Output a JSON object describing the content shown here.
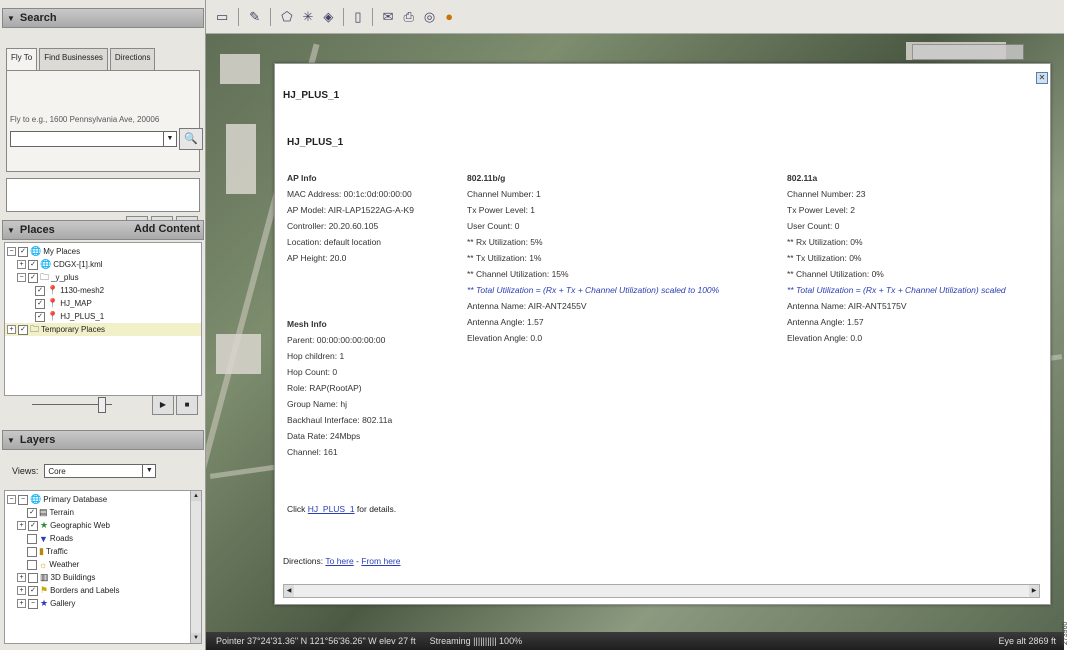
{
  "search": {
    "title": "Search",
    "tabs": [
      "Fly To",
      "Find Businesses",
      "Directions"
    ],
    "hint": "Fly to e.g., 1600 Pennsylvania Ave, 20006",
    "input_value": "",
    "buttons": {
      "play": "▶",
      "stop": "■",
      "close": "✕"
    }
  },
  "places": {
    "title": "Places",
    "add_content": "Add Content",
    "items": [
      {
        "label": "My Places"
      },
      {
        "label": "CDGX-[1].kml"
      },
      {
        "label": "_y_plus"
      },
      {
        "label": "1130-mesh2"
      },
      {
        "label": "HJ_MAP"
      },
      {
        "label": "HJ_PLUS_1"
      },
      {
        "label": "Temporary Places"
      }
    ]
  },
  "layers": {
    "title": "Layers",
    "views_label": "Views:",
    "views_value": "Core",
    "items": [
      {
        "label": "Primary Database"
      },
      {
        "label": "Terrain"
      },
      {
        "label": "Geographic Web"
      },
      {
        "label": "Roads"
      },
      {
        "label": "Traffic"
      },
      {
        "label": "Weather"
      },
      {
        "label": "3D Buildings"
      },
      {
        "label": "Borders and Labels"
      },
      {
        "label": "Gallery"
      }
    ]
  },
  "balloon": {
    "title": "HJ_PLUS_1",
    "subtitle": "HJ_PLUS_1",
    "ap_info": {
      "heading": "AP Info",
      "lines": [
        "MAC Address: 00:1c:0d:00:00:00",
        "AP Model: AIR-LAP1522AG-A-K9",
        "Controller: 20.20.60.105",
        "Location: default location",
        "AP Height: 20.0"
      ]
    },
    "mesh_info": {
      "heading": "Mesh Info",
      "lines": [
        "Parent: 00:00:00:00:00:00",
        "Hop children: 1",
        "Hop Count: 0",
        "Role: RAP(RootAP)",
        "Group Name: hj",
        "Backhaul Interface: 802.11a",
        "Data Rate: 24Mbps",
        "Channel: 161"
      ]
    },
    "bg": {
      "heading": "802.11b/g",
      "lines": [
        "Channel Number: 1",
        "Tx Power Level: 1",
        "User Count: 0",
        "** Rx Utilization: 5%",
        "** Tx Utilization: 1%",
        "** Channel Utilization: 15%"
      ],
      "note": "** Total Utilization = (Rx + Tx + Channel Utilization) scaled to 100%",
      "lines2": [
        "Antenna Name: AIR-ANT2455V",
        "Antenna Angle: 1.57",
        "Elevation Angle: 0.0"
      ]
    },
    "a": {
      "heading": "802.11a",
      "lines": [
        "Channel Number: 23",
        "Tx Power Level: 2",
        "User Count: 0",
        "** Rx Utilization: 0%",
        "** Tx Utilization: 0%",
        "** Channel Utilization: 0%"
      ],
      "note": "** Total Utilization = (Rx + Tx + Channel Utilization) scaled",
      "lines2": [
        "Antenna Name: AIR-ANT5175V",
        "Antenna Angle: 1.57",
        "Elevation Angle: 0.0"
      ]
    },
    "click_prefix": "Click ",
    "click_link": "HJ_PLUS_1",
    "click_suffix": " for details.",
    "directions_label": "Directions: ",
    "to_here": "To here",
    "dash": " - ",
    "from_here": "From here"
  },
  "status": {
    "pointer": "Pointer  37°24'31.36\" N  121°56'36.26\" W  elev  27 ft",
    "streaming": "Streaming |||||||||| 100%",
    "eye_alt": "Eye alt   2869 ft"
  },
  "figure_id": "273960"
}
